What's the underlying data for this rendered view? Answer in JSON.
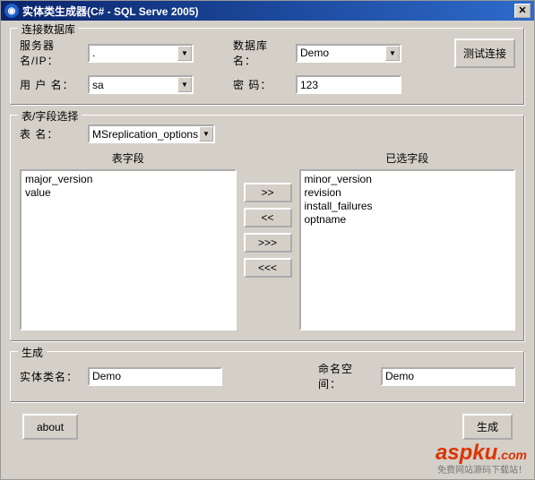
{
  "titlebar": {
    "title": "实体类生成器(C# - SQL Serve 2005)"
  },
  "db": {
    "legend": "连接数据库",
    "server_label": "服务器名/IP：",
    "server_value": ".",
    "dbname_label": "数据库名：",
    "dbname_value": "Demo",
    "user_label": "用 户 名：",
    "user_value": "sa",
    "pwd_label": "密  码：",
    "pwd_value": "123",
    "test_btn": "测试连接"
  },
  "sel": {
    "legend": "表/字段选择",
    "table_label": "表  名：",
    "table_value": "MSreplication_options",
    "available_label": "表字段",
    "selected_label": "已选字段",
    "available": [
      "major_version",
      "value"
    ],
    "selected": [
      "minor_version",
      "revision",
      "install_failures",
      "optname"
    ],
    "btn_right": ">>",
    "btn_left": "<<",
    "btn_right_all": ">>>",
    "btn_left_all": "<<<"
  },
  "gen": {
    "legend": "生成",
    "entity_label": "实体类名：",
    "entity_value": "Demo",
    "ns_label": "命名空间：",
    "ns_value": "Demo"
  },
  "bottom": {
    "about": "about",
    "generate": "生成"
  },
  "watermark": {
    "text": "aspku",
    "dotcom": ".com",
    "sub": "免费网站源码下载站！"
  }
}
